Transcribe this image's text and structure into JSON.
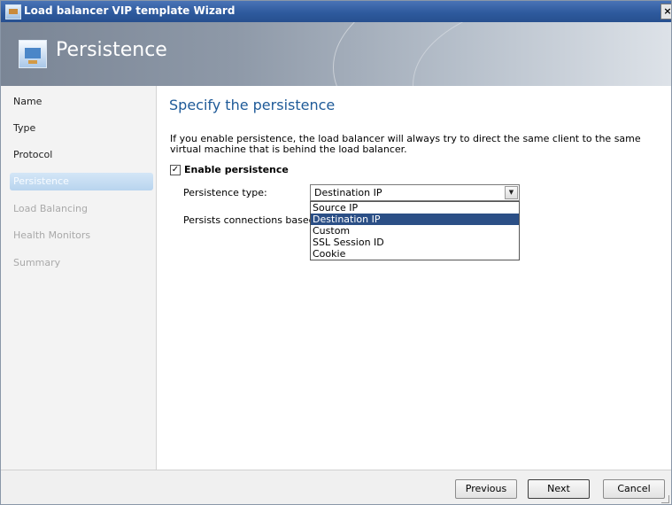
{
  "window": {
    "title": "Load balancer VIP template Wizard",
    "close_glyph": "×"
  },
  "banner": {
    "title": "Persistence",
    "icon": "wizard-page-icon"
  },
  "nav": {
    "items": [
      {
        "label": "Name",
        "state": "completed"
      },
      {
        "label": "Type",
        "state": "completed"
      },
      {
        "label": "Protocol",
        "state": "completed"
      },
      {
        "label": "Persistence",
        "state": "active"
      },
      {
        "label": "Load Balancing",
        "state": "disabled"
      },
      {
        "label": "Health Monitors",
        "state": "disabled"
      },
      {
        "label": "Summary",
        "state": "disabled"
      }
    ]
  },
  "main": {
    "heading": "Specify the persistence",
    "description": "If you enable persistence, the load balancer will always try to direct the same client to the same virtual machine that is behind the load balancer.",
    "enable_persistence": {
      "label": "Enable persistence",
      "checked": true,
      "check_glyph": "✓"
    },
    "persistence_type": {
      "label": "Persistence type:",
      "value": "Destination IP",
      "arrow_glyph": "▼",
      "options": [
        "Source IP",
        "Destination IP",
        "Custom",
        "SSL Session ID",
        "Cookie"
      ],
      "highlighted_option": "Destination IP"
    },
    "persists_label": "Persists connections based on"
  },
  "footer": {
    "previous": "Previous",
    "next": "Next",
    "cancel": "Cancel"
  },
  "colors": {
    "heading": "#1e5a98",
    "selection": "#2b4f86",
    "titlebar": "#2e5a9e"
  }
}
